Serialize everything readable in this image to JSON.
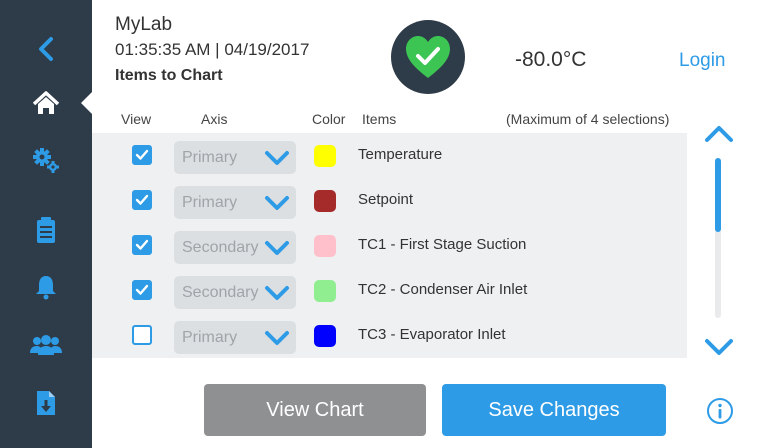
{
  "sidebar": {
    "items": [
      {
        "name": "back-icon"
      },
      {
        "name": "home-icon",
        "active": true
      },
      {
        "name": "settings-gears-icon"
      },
      {
        "name": "clipboard-icon"
      },
      {
        "name": "alarm-bell-icon"
      },
      {
        "name": "users-icon"
      },
      {
        "name": "file-download-icon"
      }
    ]
  },
  "header": {
    "device_name": "MyLab",
    "datetime": "01:35:35 AM | 04/19/2017",
    "page_title": "Items to Chart",
    "status_icon": "heart-check-icon",
    "temperature": "-80.0°C",
    "login_label": "Login"
  },
  "columns": {
    "view": "View",
    "axis": "Axis",
    "color": "Color",
    "items": "Items",
    "max_note": "(Maximum of 4 selections)"
  },
  "rows": [
    {
      "checked": true,
      "axis": "Primary",
      "color": "#ffff00",
      "label": "Temperature"
    },
    {
      "checked": true,
      "axis": "Primary",
      "color": "#a52a2a",
      "label": "Setpoint"
    },
    {
      "checked": true,
      "axis": "Secondary",
      "color": "#ffc0cb",
      "label": "TC1 - First Stage Suction"
    },
    {
      "checked": true,
      "axis": "Secondary",
      "color": "#90ee90",
      "label": "TC2 - Condenser Air Inlet"
    },
    {
      "checked": false,
      "axis": "Primary",
      "color": "#0000ff",
      "label": "TC3 - Evaporator Inlet"
    }
  ],
  "buttons": {
    "view_chart": "View Chart",
    "save_changes": "Save Changes"
  },
  "colors": {
    "accent": "#2e9be6",
    "sidebar": "#2e3b48",
    "status_green": "#3cc553"
  }
}
